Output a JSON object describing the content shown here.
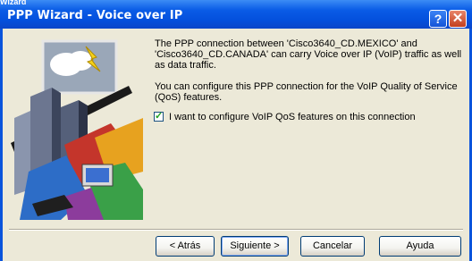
{
  "window": {
    "title": "PPP Wizard - Voice over IP",
    "title_strip_text": "Wizard",
    "help_glyph": "?",
    "close_glyph": "✕"
  },
  "content": {
    "description": "The PPP connection between 'Cisco3640_CD.MEXICO' and 'Cisco3640_CD.CANADA' can carry Voice over IP (VoIP) traffic as well as data traffic.",
    "qos_info": "You can configure this PPP connection for the VoIP Quality of Service (QoS) features.",
    "checkbox_label": "I want to configure VoIP QoS features on this connection",
    "checkbox_checked": true,
    "checkbox_mark": "✓"
  },
  "buttons": {
    "back": "< Atrás",
    "next": "Siguiente >",
    "cancel": "Cancelar",
    "help": "Ayuda"
  },
  "colors": {
    "titlebar": "#0a54dc",
    "dialog_bg": "#ece9d8",
    "close_button": "#c33f1d"
  }
}
